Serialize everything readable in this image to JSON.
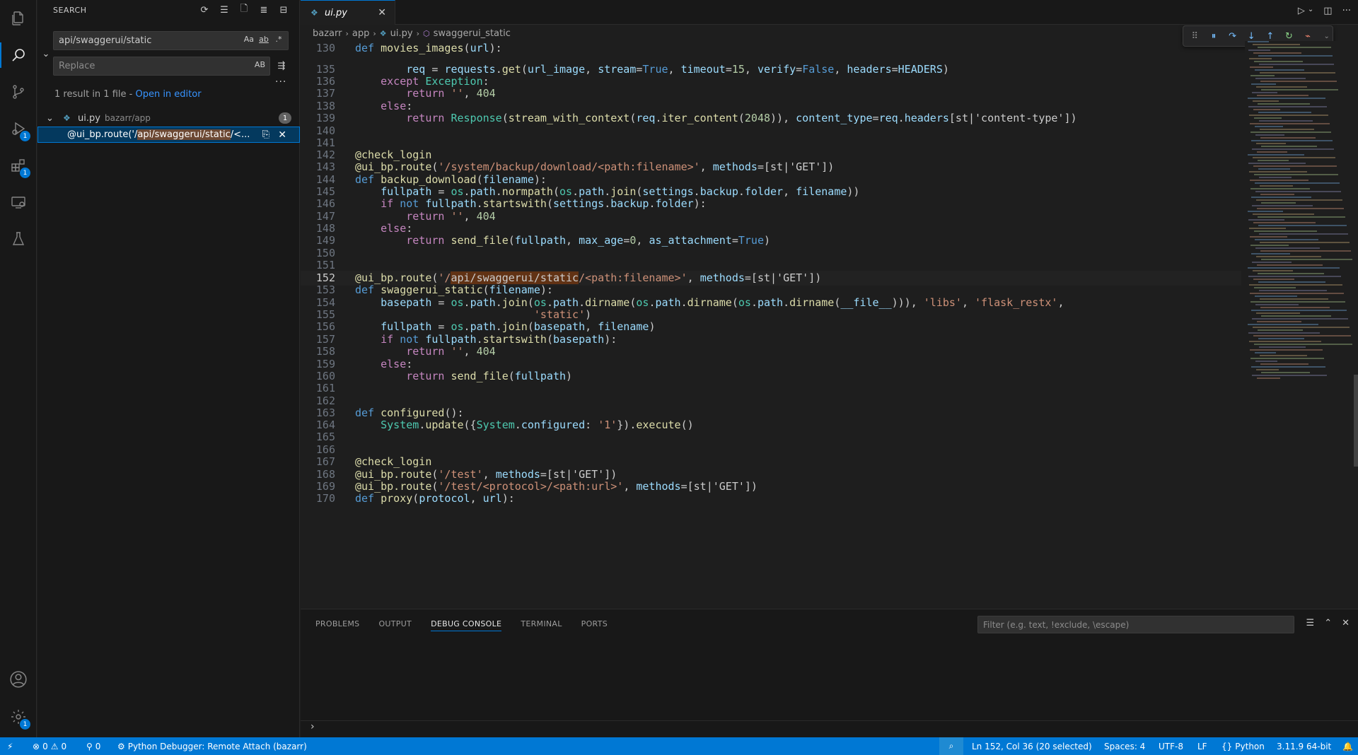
{
  "activity_bar": {
    "items": [
      "explorer-icon",
      "search-icon",
      "source-control-icon",
      "run-debug-icon",
      "extensions-icon",
      "remote-explorer-icon",
      "testing-icon"
    ],
    "run_badge": "1",
    "extensions_badge": "1",
    "settings_badge": "1"
  },
  "sidebar": {
    "title": "SEARCH",
    "search_value": "api/swaggerui/static",
    "replace_placeholder": "Replace",
    "opt_case": "Aa",
    "opt_word": "ab",
    "opt_regex": ".*",
    "opt_preserve": "AB",
    "summary": "1 result in 1 file - ",
    "open_in_editor": "Open in editor",
    "file": {
      "name": "ui.py",
      "path": "bazarr/app",
      "count": "1"
    },
    "match": {
      "pre": "@ui_bp.route('/",
      "hit": "api/swaggerui/static",
      "post": "/<..."
    }
  },
  "editor": {
    "tab_label": "ui.py",
    "breadcrumb": [
      "bazarr",
      "app",
      "ui.py",
      "swaggerui_static"
    ],
    "sticky_line": "130",
    "line_numbers": [
      "130",
      "135",
      "136",
      "137",
      "138",
      "139",
      "140",
      "141",
      "142",
      "143",
      "144",
      "145",
      "146",
      "147",
      "148",
      "149",
      "150",
      "151",
      "152",
      "153",
      "154",
      "155",
      "156",
      "157",
      "158",
      "159",
      "160",
      "161",
      "162",
      "163",
      "164",
      "165",
      "166",
      "167",
      "168",
      "169",
      "170"
    ],
    "current_line": "152"
  },
  "panel": {
    "tabs": [
      "PROBLEMS",
      "OUTPUT",
      "DEBUG CONSOLE",
      "TERMINAL",
      "PORTS"
    ],
    "active_tab": "DEBUG CONSOLE",
    "filter_placeholder": "Filter (e.g. text, !exclude, \\escape)"
  },
  "statusbar": {
    "errors": "0",
    "warnings": "0",
    "ports": "0",
    "debugger": "Python Debugger: Remote Attach (bazarr)",
    "position": "Ln 152, Col 36 (20 selected)",
    "spaces": "Spaces: 4",
    "encoding": "UTF-8",
    "eol": "LF",
    "language": "Python",
    "interpreter": "3.11.9 64-bit"
  },
  "colors": {
    "accent": "#0078d4",
    "status_bg": "#0078d4",
    "selection_match": "#613214"
  }
}
